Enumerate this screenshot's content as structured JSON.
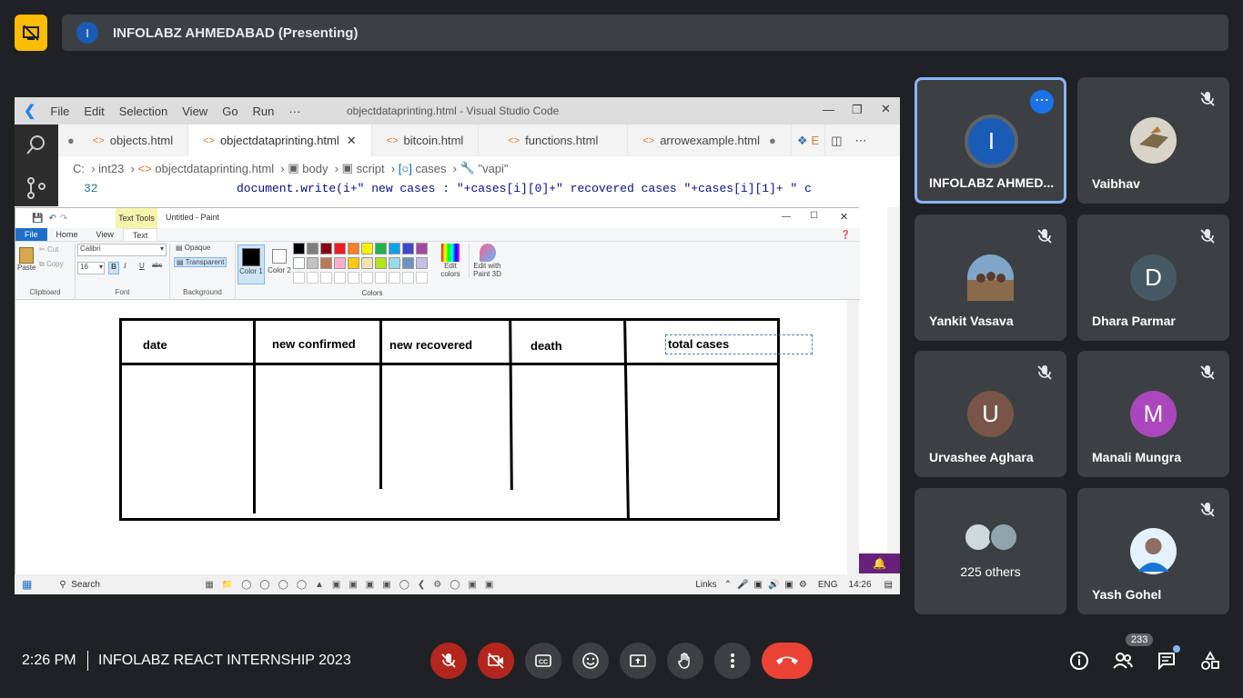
{
  "presenting": {
    "avatar_letter": "I",
    "title": "INFOLABZ AHMEDABAD (Presenting)"
  },
  "vscode": {
    "menu": [
      "File",
      "Edit",
      "Selection",
      "View",
      "Go",
      "Run",
      "···"
    ],
    "window_title": "objectdataprinting.html - Visual Studio Code",
    "tabs": [
      "objects.html",
      "objectdataprinting.html",
      "bitcoin.html",
      "functions.html",
      "arrowexample.html",
      "E"
    ],
    "breadcrumbs": [
      "C:",
      "int23",
      "objectdataprinting.html",
      "body",
      "script",
      "cases",
      "\"vapi\""
    ],
    "line_number": "32",
    "code_line": "document.write(i+\" new cases : \"+cases[i][0]+\" recovered cases \"+cases[i][1]+ \" c"
  },
  "paint": {
    "contextual_tab": "Text Tools",
    "window_title": "Untitled - Paint",
    "tabs": [
      "File",
      "Home",
      "View",
      "Text"
    ],
    "clipboard": {
      "paste": "Paste",
      "cut": "Cut",
      "copy": "Copy",
      "label": "Clipboard"
    },
    "font": {
      "family": "Calibri",
      "size": "16",
      "label": "Font"
    },
    "background": {
      "opaque": "Opaque",
      "transparent": "Transparent",
      "label": "Background"
    },
    "color1": "Color 1",
    "color2": "Color 2",
    "colors_label": "Colors",
    "edit_colors": "Edit colors",
    "edit_paint3d": "Edit with Paint 3D",
    "palette": [
      "#000000",
      "#7f7f7f",
      "#880015",
      "#ed1c24",
      "#ff7f27",
      "#fff200",
      "#22b14c",
      "#00a2e8",
      "#3f48cc",
      "#a349a4",
      "#ffffff",
      "#c3c3c3",
      "#b97a57",
      "#ffaec9",
      "#ffc90e",
      "#efe4b0",
      "#b5e61d",
      "#99d9ea",
      "#7092be",
      "#c8bfe7"
    ],
    "table_headers": [
      "date",
      "new confirmed",
      "new recovered",
      "death",
      "total cases"
    ]
  },
  "taskbar": {
    "search": "Search",
    "links": "Links",
    "lang": "ENG",
    "clock": "14:26"
  },
  "participants": [
    {
      "name": "INFOLABZ AHMED...",
      "letter": "I",
      "color": "#1a5bb5",
      "self": true
    },
    {
      "name": "Vaibhav",
      "letter": "",
      "color": "#d9d4c9"
    },
    {
      "name": "Yankit Vasava",
      "letter": "",
      "color": "#8a6b4e"
    },
    {
      "name": "Dhara Parmar",
      "letter": "D",
      "color": "#455a64"
    },
    {
      "name": "Urvashee Aghara",
      "letter": "U",
      "color": "#795548"
    },
    {
      "name": "Manali Mungra",
      "letter": "M",
      "color": "#ab47bc"
    },
    {
      "name": "225 others",
      "letter": "",
      "color": "#cfd8dc"
    },
    {
      "name": "Yash Gohel",
      "letter": "",
      "color": "#b0bec5"
    }
  ],
  "footer": {
    "time": "2:26 PM",
    "meeting": "INFOLABZ REACT INTERNSHIP 2023",
    "people_count": "233"
  },
  "colors": {
    "accent": "#8ab4f8",
    "end_call": "#ea4335",
    "present_button": "#fbbc04"
  }
}
